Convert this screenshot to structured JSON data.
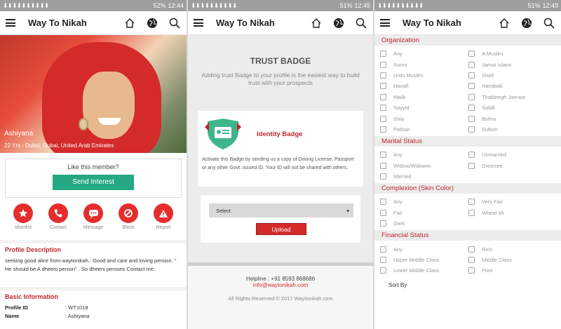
{
  "status_bars": [
    {
      "battery": "52%",
      "time": "12:44"
    },
    {
      "battery": "51%",
      "time": "12:45"
    },
    {
      "battery": "51%",
      "time": "12:49"
    }
  ],
  "app_title": "Way To Nikah",
  "icons": {
    "menu": "hamburger-menu-icon",
    "home": "home-icon",
    "globe": "globe-icon",
    "search": "search-icon"
  },
  "colors": {
    "accent_red": "#c0272d",
    "button_green": "#25a883",
    "action_red": "#e52d2d"
  },
  "profile": {
    "name": "Ashiyana",
    "location": "22 Yrs - Dubai, Dubai, United Arab Emirates",
    "like_prompt": "Like this member?",
    "send_interest": "Send Interest",
    "actions": [
      {
        "label": "shortlist",
        "icon": "star-icon"
      },
      {
        "label": "Contact",
        "icon": "phone-icon"
      },
      {
        "label": "Message",
        "icon": "chat-icon"
      },
      {
        "label": "Block",
        "icon": "block-icon"
      },
      {
        "label": "Report",
        "icon": "warning-icon"
      }
    ],
    "description_heading": "Profile Description",
    "description": "seeking good alice from waytonikah.. Good and care and loving persion. \" He should be A dheeni person\" . So dheeni persons Contact me.",
    "basic_heading": "Basic Information",
    "basic": [
      {
        "key": "Profile ID",
        "value": ": WT1018"
      },
      {
        "key": "Name",
        "value": ": Ashiyana"
      }
    ]
  },
  "trust": {
    "heading": "TRUST BADGE",
    "subheading": "Adding trust Badge to your profile is the easiest way to build trust with your prospects",
    "badge_title": "Identity Badge",
    "badge_text": "Activate this Badge by sending us a copy of Driving License, Passport or any other Govt. issued ID. Your ID will not be shared with others.",
    "select_label": "Select",
    "upload_label": "Upload",
    "helpline": "Helpline : +91 8593 868686",
    "email": "info@waytonikah.com",
    "copyright": "All Rights Reserved © 2017 Waytonikah.com"
  },
  "filters": {
    "organization": {
      "heading": "Organization",
      "options": [
        "Any",
        "A Muslim",
        "Sunni",
        "Jamat Islami",
        "Urdu Muslim",
        "Shafi",
        "Hanafi",
        "Hanabali",
        "Malik",
        "Thableegh Jamaat",
        "Sayyid",
        "Salafi",
        "Shia",
        "Bohra",
        "Pathan",
        "Sufism"
      ]
    },
    "marital": {
      "heading": "Marital Status",
      "options": [
        "Any",
        "Unmarried",
        "Widow/Widower",
        "Divorcee",
        "Married"
      ]
    },
    "complexion": {
      "heading": "Complexion (Skin Color)",
      "options": [
        "Any",
        "Very Fair",
        "Fair",
        "Wheat sh",
        "Dark"
      ]
    },
    "financial": {
      "heading": "Financial Status",
      "options": [
        "Any",
        "Rich",
        "Upper Middle Class",
        "Middle Class",
        "Lower Middle Class",
        "Poor"
      ]
    },
    "sort_by": "Sort By"
  }
}
